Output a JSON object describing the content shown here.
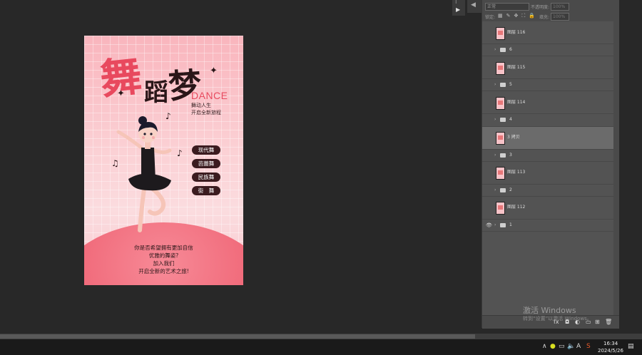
{
  "poster": {
    "title": [
      "舞",
      "蹈",
      "梦"
    ],
    "title_en": "DANCE",
    "subtitle": [
      "舞动人生",
      "开启全新旅程"
    ],
    "dance_tags": [
      "现代舞",
      "芭蕾舞",
      "民族舞",
      "街　舞"
    ],
    "slogan": [
      "你是否希望拥有更加自信",
      "优雅的舞姿?",
      "加入我们",
      "开启全新的艺术之旅!"
    ]
  },
  "panel": {
    "blend_mode": "正常",
    "opacity_label": "不透明度:",
    "opacity_value": "100%",
    "lock_label": "锁定:",
    "fill_label": "填充:",
    "fill_value": "100%",
    "layers": [
      {
        "type": "layer",
        "name": "图层 116",
        "visible": false,
        "selected": false
      },
      {
        "type": "group",
        "name": "6",
        "visible": false,
        "selected": false
      },
      {
        "type": "layer",
        "name": "图层 115",
        "visible": false,
        "selected": false
      },
      {
        "type": "group",
        "name": "5",
        "visible": false,
        "selected": false
      },
      {
        "type": "layer",
        "name": "图层 114",
        "visible": false,
        "selected": false
      },
      {
        "type": "group",
        "name": "4",
        "visible": false,
        "selected": false
      },
      {
        "type": "layer",
        "name": "3 拷贝",
        "visible": false,
        "selected": true
      },
      {
        "type": "group",
        "name": "3",
        "visible": false,
        "selected": false
      },
      {
        "type": "layer",
        "name": "图层 113",
        "visible": false,
        "selected": false
      },
      {
        "type": "group",
        "name": "2",
        "visible": false,
        "selected": false
      },
      {
        "type": "layer",
        "name": "图层 112",
        "visible": false,
        "selected": false
      },
      {
        "type": "group",
        "name": "1",
        "visible": true,
        "selected": false
      }
    ]
  },
  "watermark": {
    "line1": "激活 Windows",
    "line2": "转到“设置”以激活 Windows。"
  },
  "taskbar": {
    "time": "16:34",
    "date": "2024/5/26",
    "ime_label": "A"
  },
  "colors": {
    "accent_pink": "#e8495e",
    "dark_brown": "#2a1618",
    "tag_bg": "#3b1b1f",
    "panel_bg": "#535353",
    "canvas_bg": "#282828"
  }
}
